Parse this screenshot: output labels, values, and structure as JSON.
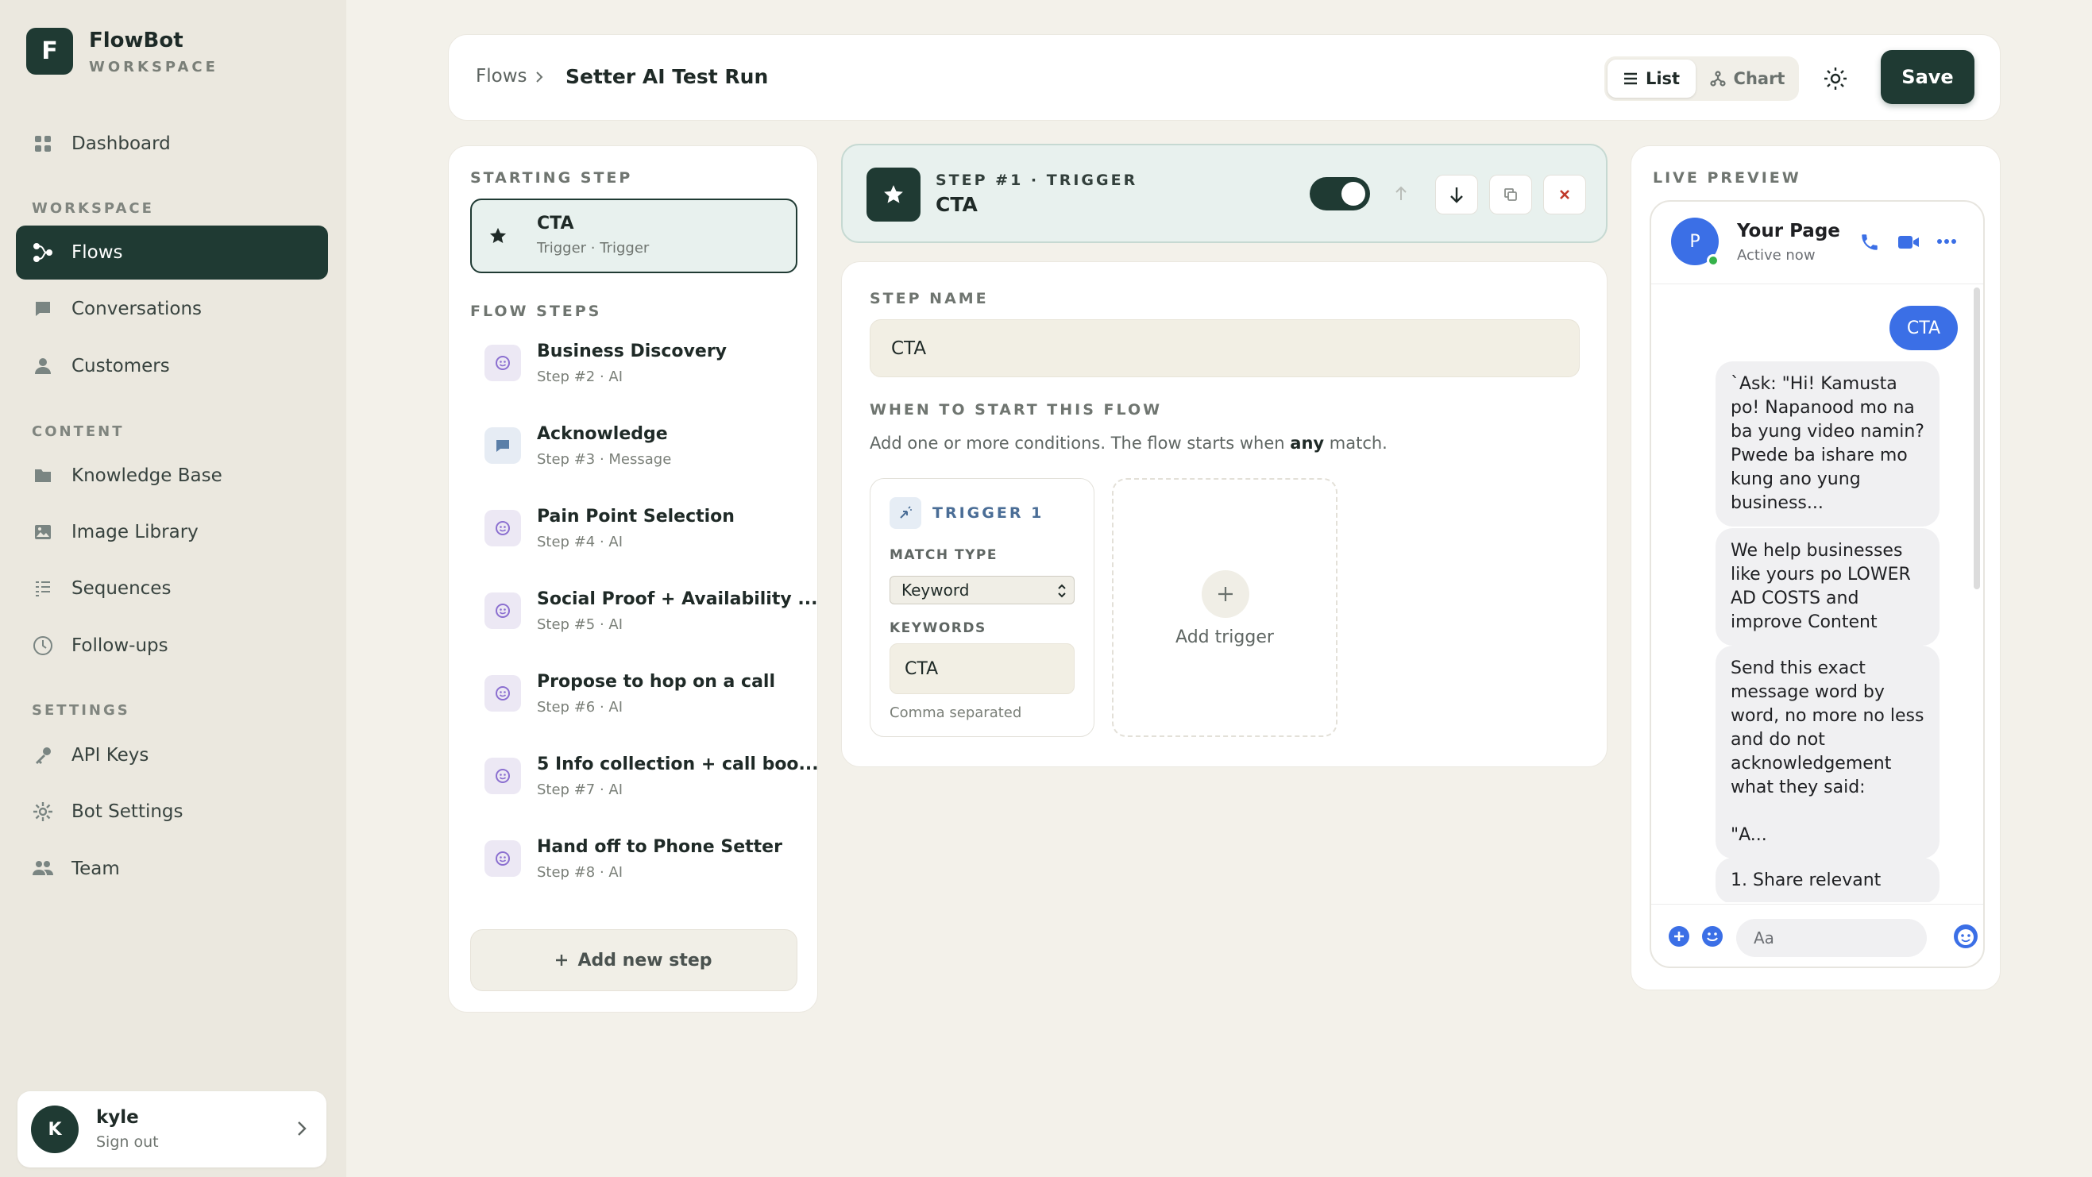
{
  "sidebar": {
    "brand": {
      "logo_letter": "F",
      "name": "FlowBot",
      "subtitle": "WORKSPACE"
    },
    "top_items": [
      {
        "label": "Dashboard",
        "icon": "grid-icon"
      }
    ],
    "sections": [
      {
        "label": "WORKSPACE",
        "items": [
          {
            "label": "Flows",
            "icon": "flow-icon",
            "active": true
          },
          {
            "label": "Conversations",
            "icon": "chat-icon"
          },
          {
            "label": "Customers",
            "icon": "person-icon"
          }
        ]
      },
      {
        "label": "CONTENT",
        "items": [
          {
            "label": "Knowledge Base",
            "icon": "folder-icon"
          },
          {
            "label": "Image Library",
            "icon": "image-icon"
          },
          {
            "label": "Sequences",
            "icon": "list-icon"
          },
          {
            "label": "Follow-ups",
            "icon": "clock-icon"
          }
        ]
      },
      {
        "label": "SETTINGS",
        "items": [
          {
            "label": "API Keys",
            "icon": "key-icon"
          },
          {
            "label": "Bot Settings",
            "icon": "gear-icon"
          },
          {
            "label": "Team",
            "icon": "team-icon"
          }
        ]
      }
    ],
    "user": {
      "initial": "K",
      "name": "kyle",
      "action": "Sign out"
    }
  },
  "header": {
    "breadcrumb_root": "Flows",
    "breadcrumb_current": "Setter AI Test Run",
    "view_toggle": [
      {
        "label": "List",
        "active": true
      },
      {
        "label": "Chart",
        "active": false
      }
    ],
    "save_label": "Save"
  },
  "steps_panel": {
    "starting_label": "STARTING STEP",
    "starting_step": {
      "title": "CTA",
      "sub": "Trigger · Trigger"
    },
    "flow_label": "FLOW STEPS",
    "steps": [
      {
        "title": "Business Discovery",
        "sub": "Step #2 · AI",
        "kind": "ai"
      },
      {
        "title": "Acknowledge",
        "sub": "Step #3 · Message",
        "kind": "message"
      },
      {
        "title": "Pain Point Selection",
        "sub": "Step #4 · AI",
        "kind": "ai"
      },
      {
        "title": "Social Proof + Availability ...",
        "sub": "Step #5 · AI",
        "kind": "ai"
      },
      {
        "title": "Propose to hop on a call",
        "sub": "Step #6 · AI",
        "kind": "ai"
      },
      {
        "title": "5 Info collection + call boo...",
        "sub": "Step #7 · AI",
        "kind": "ai"
      },
      {
        "title": "Hand off to Phone Setter",
        "sub": "Step #8 · AI",
        "kind": "ai"
      }
    ],
    "add_step_label": "Add new step"
  },
  "editor": {
    "step_meta": "STEP #1 · TRIGGER",
    "step_title": "CTA",
    "enabled": true,
    "step_name_label": "STEP NAME",
    "step_name_value": "CTA",
    "when_label": "WHEN TO START THIS FLOW",
    "when_help_prefix": "Add one or more conditions. The flow starts when ",
    "when_help_bold": "any",
    "when_help_suffix": " match.",
    "trigger": {
      "title": "TRIGGER 1",
      "match_type_label": "MATCH TYPE",
      "match_type_value": "Keyword",
      "keywords_label": "KEYWORDS",
      "keywords_value": "CTA",
      "keywords_hint": "Comma separated"
    },
    "add_trigger_label": "Add trigger"
  },
  "preview": {
    "label": "LIVE PREVIEW",
    "page_initial": "P",
    "page_name": "Your Page",
    "page_status": "Active now",
    "outgoing": "CTA",
    "messages": [
      "`Ask: \"Hi! Kamusta po! Napanood mo na ba yung video namin? Pwede ba ishare mo kung ano yung business...",
      "We help businesses like yours po LOWER AD COSTS and improve Content",
      "Send this exact message word by word, no more no less and do not acknowledgement what they said:\n\n\"A...",
      "1. Share relevant"
    ],
    "composer_placeholder": "Aa"
  },
  "colors": {
    "primary": "#1f3a33",
    "background": "#f3f1ea",
    "sidebar": "#ebe8df",
    "accent_blue": "#3b82f6",
    "ai_purple": "#8b6fd0",
    "danger": "#c0392b"
  }
}
